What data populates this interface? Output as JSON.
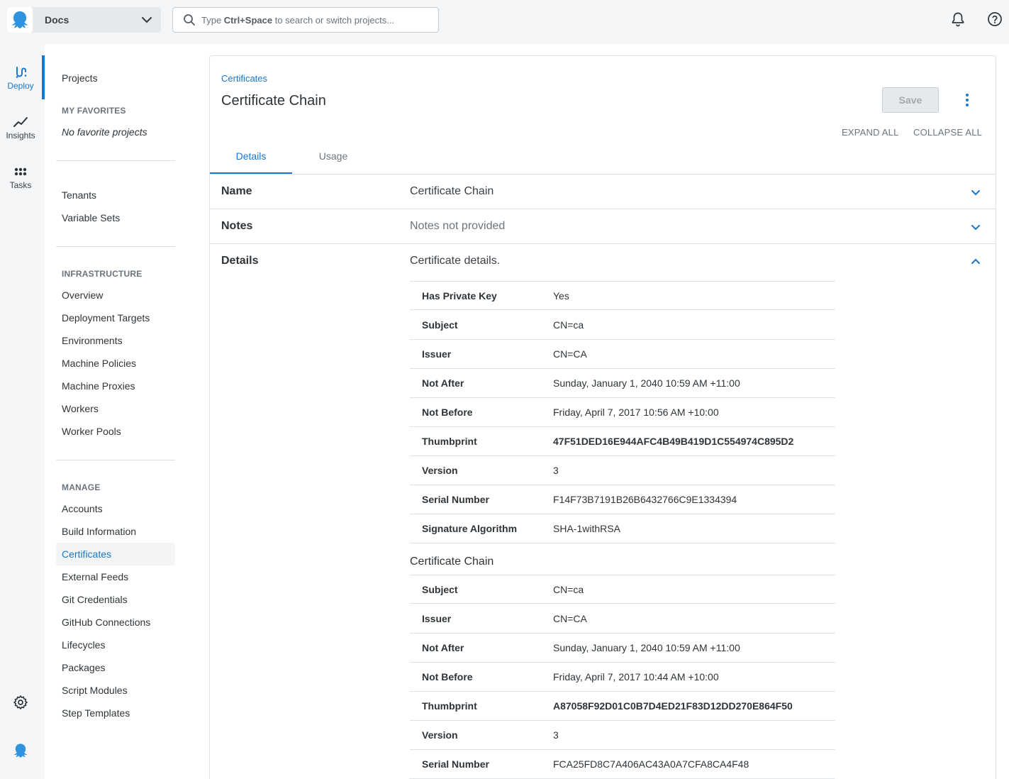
{
  "topbar": {
    "space_name": "Docs",
    "search_prefix": "Type ",
    "search_shortcut": "Ctrl+Space",
    "search_suffix": " to search or switch projects..."
  },
  "rail": {
    "deploy": "Deploy",
    "insights": "Insights",
    "tasks": "Tasks"
  },
  "sidebar": {
    "projects": "Projects",
    "favorites_heading": "MY FAVORITES",
    "no_favorites": "No favorite projects",
    "tenants": "Tenants",
    "variable_sets": "Variable Sets",
    "infrastructure_heading": "INFRASTRUCTURE",
    "infrastructure": [
      "Overview",
      "Deployment Targets",
      "Environments",
      "Machine Policies",
      "Machine Proxies",
      "Workers",
      "Worker Pools"
    ],
    "manage_heading": "MANAGE",
    "manage": [
      "Accounts",
      "Build Information",
      "Certificates",
      "External Feeds",
      "Git Credentials",
      "GitHub Connections",
      "Lifecycles",
      "Packages",
      "Script Modules",
      "Step Templates"
    ]
  },
  "page": {
    "breadcrumb": "Certificates",
    "title": "Certificate Chain",
    "save_label": "Save",
    "expand_all": "EXPAND ALL",
    "collapse_all": "COLLAPSE ALL",
    "tabs": [
      "Details",
      "Usage"
    ]
  },
  "sections": {
    "name_label": "Name",
    "name_value": "Certificate Chain",
    "notes_label": "Notes",
    "notes_value": "Notes not provided",
    "details_label": "Details",
    "details_value": "Certificate details."
  },
  "details": [
    {
      "key": "Has Private Key",
      "value": "Yes"
    },
    {
      "key": "Subject",
      "value": "CN=ca"
    },
    {
      "key": "Issuer",
      "value": "CN=CA"
    },
    {
      "key": "Not After",
      "value": "Sunday, January 1, 2040 10:59 AM +11:00"
    },
    {
      "key": "Not Before",
      "value": "Friday, April 7, 2017 10:56 AM +10:00"
    },
    {
      "key": "Thumbprint",
      "value": "47F51DED16E944AFC4B49B419D1C554974C895D2"
    },
    {
      "key": "Version",
      "value": "3"
    },
    {
      "key": "Serial Number",
      "value": "F14F73B7191B26B6432766C9E1334394"
    },
    {
      "key": "Signature Algorithm",
      "value": "SHA-1withRSA"
    }
  ],
  "chain_heading": "Certificate Chain",
  "chain": [
    {
      "key": "Subject",
      "value": "CN=ca"
    },
    {
      "key": "Issuer",
      "value": "CN=CA"
    },
    {
      "key": "Not After",
      "value": "Sunday, January 1, 2040 10:59 AM +11:00"
    },
    {
      "key": "Not Before",
      "value": "Friday, April 7, 2017 10:44 AM +10:00"
    },
    {
      "key": "Thumbprint",
      "value": "A87058F92D01C0B7D4ED21F83D12DD270E864F50"
    },
    {
      "key": "Version",
      "value": "3"
    },
    {
      "key": "Serial Number",
      "value": "FCA25FD8C7A406AC43A0A7CFA8CA4F48"
    }
  ]
}
